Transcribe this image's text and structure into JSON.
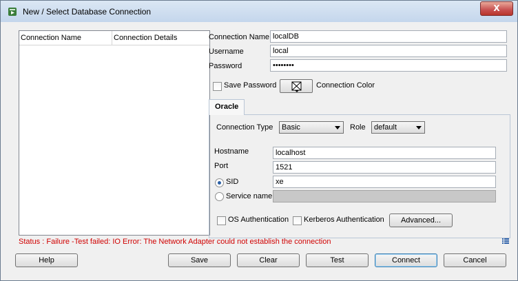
{
  "window": {
    "title": "New / Select Database Connection",
    "close_label": "X"
  },
  "list": {
    "col1": "Connection Name",
    "col2": "Connection Details"
  },
  "form": {
    "conn_name_label": "Connection Name",
    "conn_name_value": "localDB",
    "username_label": "Username",
    "username_value": "local",
    "password_label": "Password",
    "password_value": "••••••••",
    "save_password_label": "Save Password",
    "connection_color_label": "Connection Color"
  },
  "tab": {
    "label": "Oracle"
  },
  "oracle": {
    "conn_type_label": "Connection Type",
    "conn_type_value": "Basic",
    "role_label": "Role",
    "role_value": "default",
    "hostname_label": "Hostname",
    "hostname_value": "localhost",
    "port_label": "Port",
    "port_value": "1521",
    "sid_label": "SID",
    "sid_value": "xe",
    "service_label": "Service name",
    "os_auth_label": "OS Authentication",
    "kerberos_label": "Kerberos Authentication",
    "advanced_label": "Advanced..."
  },
  "status": {
    "text": "Status : Failure -Test failed: IO Error: The Network Adapter could not establish the connection"
  },
  "buttons": {
    "help": "Help",
    "save": "Save",
    "clear": "Clear",
    "test": "Test",
    "connect": "Connect",
    "cancel": "Cancel"
  },
  "colors": {
    "status": "#d00000",
    "accent": "#3c7fb1"
  }
}
